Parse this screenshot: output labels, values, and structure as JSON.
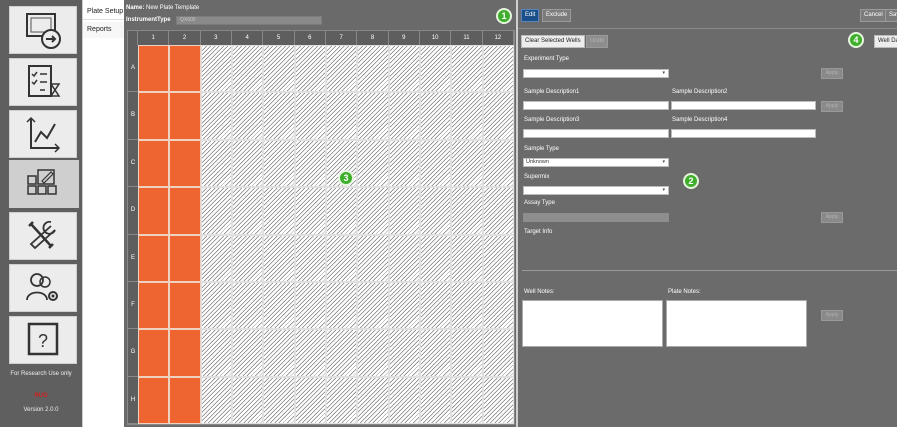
{
  "sidebar": {
    "items": [
      {
        "icon": "open-file-icon"
      },
      {
        "icon": "checklist-timer-icon"
      },
      {
        "icon": "line-chart-icon"
      },
      {
        "icon": "plate-edit-icon"
      },
      {
        "icon": "tools-icon"
      },
      {
        "icon": "users-settings-icon"
      },
      {
        "icon": "help-icon"
      }
    ],
    "research_note": "For Research Use only",
    "red_text": "RUO",
    "version": "Version 2.0.0"
  },
  "tabs": {
    "plate_setup": "Plate Setup",
    "reports": "Reports"
  },
  "plate": {
    "name_label": "Name:",
    "name_value": "New Plate Template",
    "instrument_label": "InstrumentType",
    "instrument_placeholder": "QX600",
    "columns": [
      "1",
      "2",
      "3",
      "4",
      "5",
      "6",
      "7",
      "8",
      "9",
      "10",
      "11",
      "12"
    ],
    "rows": [
      "A",
      "B",
      "C",
      "D",
      "E",
      "F",
      "G",
      "H"
    ],
    "filled_columns": 2
  },
  "toolbar": {
    "edit": "Edit",
    "exclude": "Exclude",
    "cancel": "Cancel",
    "save": "Save",
    "clear_selected": "Clear Selected Wells",
    "undo": "Undo",
    "well_data": "Well Data"
  },
  "form": {
    "experiment_type_label": "Experiment Type",
    "experiment_type_value": "",
    "sample_desc1_label": "Sample Description1",
    "sample_desc2_label": "Sample Description2",
    "sample_desc3_label": "Sample Description3",
    "sample_desc4_label": "Sample Description4",
    "sample_type_label": "Sample Type",
    "sample_type_value": "Unknown",
    "supermix_label": "Supermix",
    "supermix_value": "",
    "assay_type_label": "Assay Type",
    "target_info_label": "Target Info",
    "apply": "Apply",
    "well_notes_label": "Well Notes:",
    "plate_notes_label": "Plate Notes:"
  },
  "callouts": {
    "one": "1",
    "two": "2",
    "three": "3",
    "four": "4"
  },
  "colors": {
    "filled_well": "#ef6532",
    "badge": "#3fae2b",
    "edit_button": "#1a4f8a"
  }
}
